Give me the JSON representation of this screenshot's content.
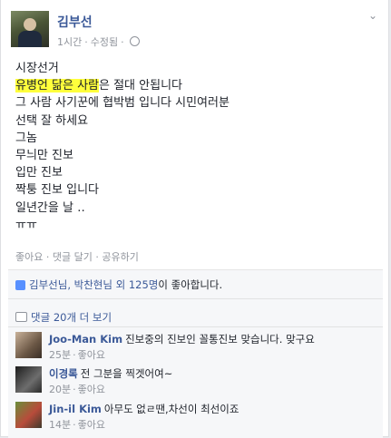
{
  "post": {
    "author": "김부선",
    "time": "1시간",
    "edited": "수정됨",
    "lines": [
      "시장선거",
      "그 사람 사기꾼에 협박범 입니다 시민여러분",
      "선택 잘 하세요",
      "그놈",
      "무늬만 진보",
      "입만 진보",
      "짝퉁 진보 입니다",
      "일년간을 날 ‥",
      "ㅠㅠ"
    ],
    "line2_highlight": "유병언 닮은 사람",
    "line2_rest": "은 절대 안됩니다",
    "actions": {
      "like": "좋아요",
      "comment": "댓글 달기",
      "share": "공유하기"
    }
  },
  "likes": {
    "names": "김부선님, 박찬현님 외",
    "count_link": "125명",
    "suffix": "이 좋아합니다."
  },
  "more_comments": "댓글 20개 더 보기",
  "comments": [
    {
      "name": "Joo-Man Kim",
      "text": "진보중의 진보인 꼴통진보 맞습니다. 맞구요",
      "time": "25분",
      "like": "좋아요"
    },
    {
      "name": "이경록",
      "text": "전 그분을 찍겟어여~",
      "time": "20분",
      "like": "좋아요"
    },
    {
      "name": "Jin-il Kim",
      "text": "아무도 없ㄹ땐,차선이 최선이죠",
      "time": "14분",
      "like": "좋아요"
    }
  ]
}
